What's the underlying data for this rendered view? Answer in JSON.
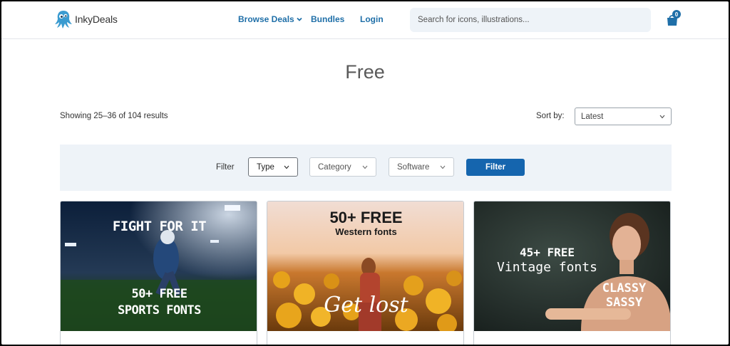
{
  "brand": {
    "name": "InkyDeals"
  },
  "nav": {
    "browse_label": "Browse Deals",
    "bundles_label": "Bundles",
    "login_label": "Login"
  },
  "search": {
    "placeholder": "Search for icons, illustrations..."
  },
  "cart": {
    "count": "0"
  },
  "page": {
    "title": "Free"
  },
  "results": {
    "text": "Showing 25–36 of 104 results"
  },
  "sort": {
    "label": "Sort by:",
    "selected": "Latest"
  },
  "filter": {
    "label": "Filter",
    "type_label": "Type",
    "category_label": "Category",
    "software_label": "Software",
    "button_label": "Filter"
  },
  "products": [
    {
      "line1": "FIGHT FOR IT",
      "line2": "50+ FREE",
      "line3": "SPORTS FONTS"
    },
    {
      "line1": "50+ FREE",
      "line2": "Western fonts",
      "line3": "Get lost"
    },
    {
      "line1": "45+ FREE",
      "line2": "Vintage fonts",
      "line3": "CLASSY",
      "line4": "SASSY"
    }
  ],
  "colors": {
    "accent": "#1565ae",
    "link": "#1f6fa8",
    "filter_bg": "#eef3f8"
  }
}
